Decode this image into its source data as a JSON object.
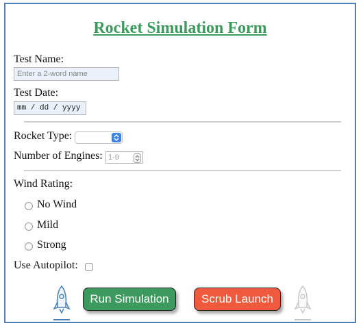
{
  "form": {
    "title": "Rocket Simulation Form",
    "test_name": {
      "label": "Test Name:",
      "placeholder": "Enter a 2-word name"
    },
    "test_date": {
      "label": "Test Date:",
      "value": "mm / dd / yyyy"
    },
    "rocket_type": {
      "label": "Rocket Type:",
      "selected": ""
    },
    "engines": {
      "label": "Number of Engines:",
      "placeholder": "1-9"
    },
    "wind": {
      "label": "Wind Rating:",
      "options": [
        "No Wind",
        "Mild",
        "Strong"
      ]
    },
    "autopilot": {
      "label": "Use Autopilot:"
    },
    "buttons": {
      "run": "Run Simulation",
      "scrub": "Scrub Launch"
    }
  },
  "colors": {
    "title": "#3d9a5e",
    "run_button": "#3d9a5e",
    "scrub_button": "#f05a3c",
    "frame_border": "#4a80b8",
    "rocket_left": "#4a80b8",
    "rocket_right": "#c8c8c8"
  },
  "icons": {
    "left": "rocket-icon",
    "right": "rocket-icon"
  }
}
